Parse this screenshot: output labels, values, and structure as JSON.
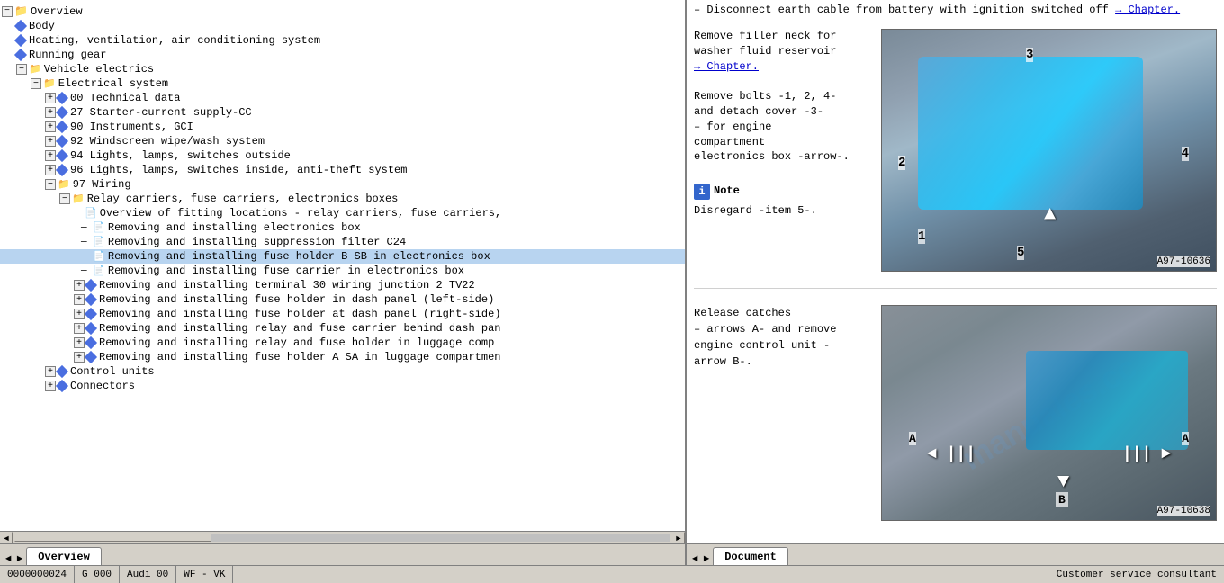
{
  "tree": {
    "items": [
      {
        "id": "overview",
        "label": "Overview",
        "level": 0,
        "type": "folder-open",
        "expanded": true
      },
      {
        "id": "body",
        "label": "Body",
        "level": 1,
        "type": "blue-diamond",
        "expanded": false
      },
      {
        "id": "hvac",
        "label": "Heating, ventilation, air conditioning system",
        "level": 1,
        "type": "blue-diamond",
        "expanded": false
      },
      {
        "id": "running-gear",
        "label": "Running gear",
        "level": 1,
        "type": "blue-diamond",
        "expanded": false
      },
      {
        "id": "vehicle-electrics",
        "label": "Vehicle electrics",
        "level": 1,
        "type": "folder-open",
        "expanded": true
      },
      {
        "id": "electrical-system",
        "label": "Electrical system",
        "level": 2,
        "type": "folder-open",
        "expanded": true
      },
      {
        "id": "00-tech",
        "label": "00 Technical data",
        "level": 3,
        "type": "blue-diamond-expand",
        "expanded": false
      },
      {
        "id": "27-starter",
        "label": "27 Starter-current supply-CC",
        "level": 3,
        "type": "blue-diamond-expand",
        "expanded": false
      },
      {
        "id": "90-instruments",
        "label": "90 Instruments, GCI",
        "level": 3,
        "type": "blue-diamond-expand",
        "expanded": false
      },
      {
        "id": "92-windscreen",
        "label": "92 Windscreen wipe/wash system",
        "level": 3,
        "type": "blue-diamond-expand",
        "expanded": false
      },
      {
        "id": "94-lights",
        "label": "94 Lights, lamps, switches outside",
        "level": 3,
        "type": "blue-diamond-expand",
        "expanded": false
      },
      {
        "id": "96-lights",
        "label": "96 Lights, lamps, switches inside, anti-theft system",
        "level": 3,
        "type": "blue-diamond-expand",
        "expanded": false
      },
      {
        "id": "97-wiring",
        "label": "97 Wiring",
        "level": 3,
        "type": "folder-open-expand",
        "expanded": true
      },
      {
        "id": "relay-carriers",
        "label": "Relay carriers, fuse carriers, electronics boxes",
        "level": 4,
        "type": "folder-open",
        "expanded": true
      },
      {
        "id": "overview-fitting",
        "label": "Overview of fitting locations - relay carriers, fuse carriers,",
        "level": 5,
        "type": "doc",
        "expanded": false
      },
      {
        "id": "removing-electronics",
        "label": "Removing and installing electronics box",
        "level": 5,
        "type": "doc",
        "expanded": false,
        "selected": false
      },
      {
        "id": "removing-suppression",
        "label": "Removing and installing suppression filter C24",
        "level": 5,
        "type": "doc",
        "expanded": false
      },
      {
        "id": "removing-fuse-sb",
        "label": "Removing and installing fuse holder B SB in electronics box",
        "level": 5,
        "type": "doc",
        "expanded": false,
        "highlighted": true
      },
      {
        "id": "removing-fuse-carrier",
        "label": "Removing and installing fuse carrier in electronics box",
        "level": 5,
        "type": "doc",
        "expanded": false
      },
      {
        "id": "removing-terminal30",
        "label": "Removing and installing terminal 30 wiring junction 2 TV22",
        "level": 5,
        "type": "blue-diamond-expand",
        "expanded": false
      },
      {
        "id": "removing-fuse-dash-left",
        "label": "Removing and installing fuse holder in dash panel (left-side)",
        "level": 5,
        "type": "blue-diamond-expand",
        "expanded": false
      },
      {
        "id": "removing-fuse-dash-right",
        "label": "Removing and installing fuse holder at dash panel (right-side)",
        "level": 5,
        "type": "blue-diamond-expand",
        "expanded": false
      },
      {
        "id": "removing-relay-dash",
        "label": "Removing and installing relay and fuse carrier behind dash pan",
        "level": 5,
        "type": "blue-diamond-expand",
        "expanded": false
      },
      {
        "id": "removing-relay-luggage",
        "label": "Removing and installing relay and fuse holder in luggage comp",
        "level": 5,
        "type": "blue-diamond-expand",
        "expanded": false
      },
      {
        "id": "removing-fuse-sa",
        "label": "Removing and installing fuse holder A SA in luggage compartmen",
        "level": 5,
        "type": "blue-diamond-expand",
        "expanded": false
      },
      {
        "id": "control-units",
        "label": "Control units",
        "level": 3,
        "type": "blue-diamond-expand",
        "expanded": false
      },
      {
        "id": "connectors",
        "label": "Connectors",
        "level": 3,
        "type": "blue-diamond-expand",
        "expanded": false
      }
    ]
  },
  "right_panel": {
    "intro_text": "– Disconnect earth cable from battery with ignition switched off",
    "chapter_link_1": "→ Chapter.",
    "step1": {
      "text": "Remove filler neck for washer fluid reservoir",
      "link": "→ Chapter."
    },
    "step2": {
      "text": "Remove bolts -1, 2, 4- and detach cover -3- for engine compartment electronics box -arrow-."
    },
    "note_label": "Note",
    "note_text": "Disregard -item 5-.",
    "image1_ref": "A97-10636",
    "labels_img1": {
      "1": "1",
      "2": "2",
      "3": "3",
      "4": "4",
      "5": "5"
    },
    "step3": {
      "text": "Release catches – arrows A- and remove engine control unit - arrow B-."
    },
    "image2_ref": "A97-10638",
    "labels_img2": {
      "A_left": "A",
      "A_right": "A",
      "B": "B"
    }
  },
  "bottom_tabs": {
    "left_tab": "Overview",
    "right_tab": "Document"
  },
  "status_bar": {
    "code": "0000000024",
    "doc_id": "G 000",
    "car_model": "Audi 00",
    "engine_code": "WF - VK",
    "consultant": "Customer service consultant"
  }
}
